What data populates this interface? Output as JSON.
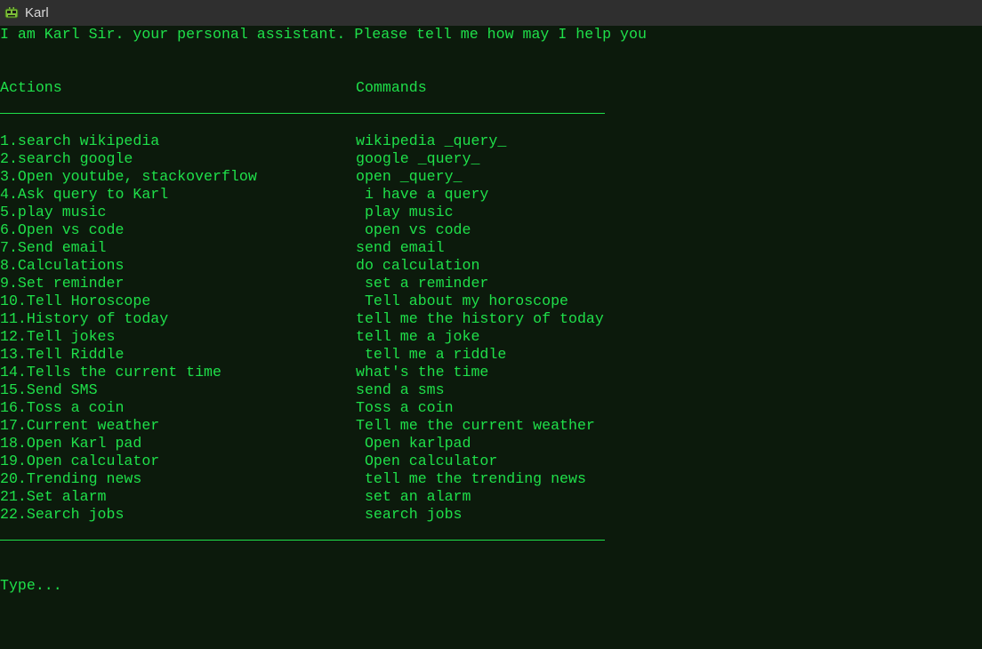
{
  "window": {
    "title": "Karl"
  },
  "console": {
    "greeting": "I am Karl Sir. your personal assistant. Please tell me how may I help you",
    "header": {
      "actions": "Actions",
      "commands": "Commands"
    },
    "rows": [
      {
        "action": "1.search wikipedia",
        "command": "wikipedia _query_"
      },
      {
        "action": "2.search google",
        "command": "google _query_"
      },
      {
        "action": "3.Open youtube, stackoverflow",
        "command": "open _query_"
      },
      {
        "action": "4.Ask query to Karl",
        "command": " i have a query"
      },
      {
        "action": "5.play music",
        "command": " play music"
      },
      {
        "action": "6.Open vs code",
        "command": " open vs code"
      },
      {
        "action": "7.Send email",
        "command": "send email"
      },
      {
        "action": "8.Calculations",
        "command": "do calculation"
      },
      {
        "action": "9.Set reminder",
        "command": " set a reminder"
      },
      {
        "action": "10.Tell Horoscope",
        "command": " Tell about my horoscope"
      },
      {
        "action": "11.History of today",
        "command": "tell me the history of today"
      },
      {
        "action": "12.Tell jokes",
        "command": "tell me a joke"
      },
      {
        "action": "13.Tell Riddle",
        "command": " tell me a riddle"
      },
      {
        "action": "14.Tells the current time",
        "command": "what's the time"
      },
      {
        "action": "15.Send SMS",
        "command": "send a sms"
      },
      {
        "action": "16.Toss a coin",
        "command": "Toss a coin"
      },
      {
        "action": "17.Current weather",
        "command": "Tell me the current weather"
      },
      {
        "action": "18.Open Karl pad",
        "command": " Open karlpad"
      },
      {
        "action": "19.Open calculator",
        "command": " Open calculator"
      },
      {
        "action": "20.Trending news",
        "command": " tell me the trending news"
      },
      {
        "action": "21.Set alarm",
        "command": " set an alarm"
      },
      {
        "action": "22.Search jobs",
        "command": " search jobs"
      }
    ],
    "prompt": "Type..."
  },
  "colors": {
    "background": "#0c1a0c",
    "text": "#1fe04a",
    "titlebar": "#2f2f2f"
  }
}
